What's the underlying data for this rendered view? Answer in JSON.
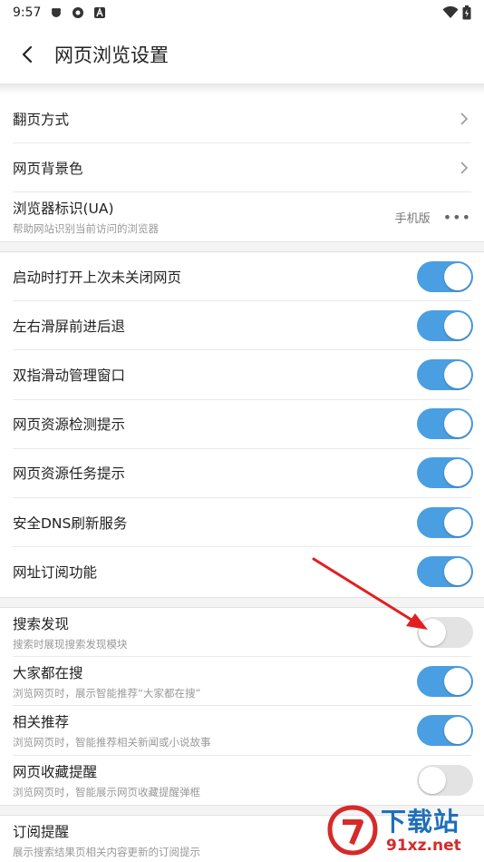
{
  "status_bar": {
    "time": "9:57"
  },
  "header": {
    "title": "网页浏览设置"
  },
  "section1": {
    "items": [
      {
        "title": "翻页方式"
      },
      {
        "title": "网页背景色"
      },
      {
        "title": "浏览器标识(UA)",
        "subtitle": "帮助网站识别当前访问的浏览器",
        "value": "手机版",
        "more": "•••"
      }
    ]
  },
  "section2": {
    "items": [
      {
        "title": "启动时打开上次未关闭网页",
        "on": true
      },
      {
        "title": "左右滑屏前进后退",
        "on": true
      },
      {
        "title": "双指滑动管理窗口",
        "on": true
      },
      {
        "title": "网页资源检测提示",
        "on": true
      },
      {
        "title": "网页资源任务提示",
        "on": true
      },
      {
        "title": "安全DNS刷新服务",
        "on": true
      },
      {
        "title": "网址订阅功能",
        "on": true
      }
    ]
  },
  "section3": {
    "items": [
      {
        "title": "搜索发现",
        "subtitle": "搜索时展现搜索发现模块",
        "on": false
      },
      {
        "title": "大家都在搜",
        "subtitle": "浏览网页时，展示智能推荐“大家都在搜”",
        "on": true
      },
      {
        "title": "相关推荐",
        "subtitle": "浏览网页时，智能推荐相关新闻或小说故事",
        "on": true
      },
      {
        "title": "网页收藏提醒",
        "subtitle": "浏览网页时，智能展示网页收藏提醒弹框",
        "on": false
      }
    ]
  },
  "section4": {
    "items": [
      {
        "title": "订阅提醒",
        "subtitle": "展示搜索结果页相关内容更新的订阅提示"
      }
    ]
  },
  "watermark": {
    "title": "下载站",
    "url": "91xz.net"
  },
  "colors": {
    "toggle_on": "#4a9ee2",
    "toggle_off": "#e3e3e3",
    "arrow": "#e02020"
  }
}
